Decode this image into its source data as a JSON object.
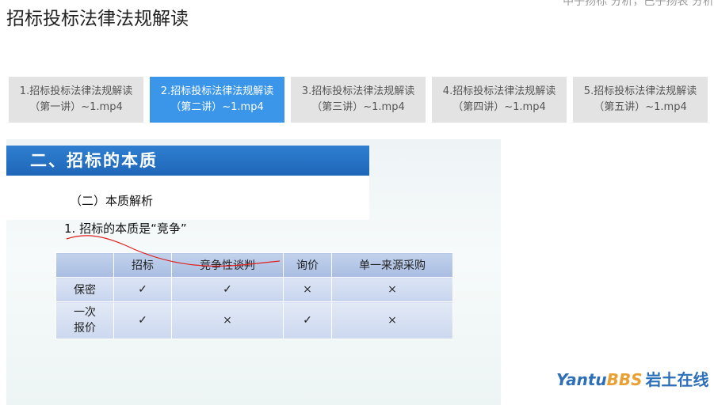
{
  "page": {
    "title": "招标投标法律法规解读"
  },
  "top_cut_text": "中子扬标  分析，巴子扬表  分析",
  "tabs": [
    {
      "line1": "1.招标投标法律法规解读",
      "line2": "（第一讲）~1.mp4",
      "active": false
    },
    {
      "line1": "2.招标投标法律法规解读",
      "line2": "（第二讲）~1.mp4",
      "active": true
    },
    {
      "line1": "3.招标投标法律法规解读",
      "line2": "（第三讲）~1.mp4",
      "active": false
    },
    {
      "line1": "4.招标投标法律法规解读",
      "line2": "（第四讲）~1.mp4",
      "active": false
    },
    {
      "line1": "5.招标投标法律法规解读",
      "line2": "（第五讲）~1.mp4",
      "active": false
    }
  ],
  "slide": {
    "heading": "二、招标的本质",
    "subheading": "（二）本质解析",
    "point": "1. 招标的本质是“竞争”",
    "table": {
      "headers": [
        "",
        "招标",
        "竞争性谈判",
        "询价",
        "单一来源采购"
      ],
      "rows": [
        {
          "label_line1": "保密",
          "label_line2": "",
          "cells": [
            "✓",
            "✓",
            "×",
            "×"
          ]
        },
        {
          "label_line1": "一次",
          "label_line2": "报价",
          "cells": [
            "✓",
            "×",
            "✓",
            "×"
          ]
        }
      ]
    },
    "pen_color": "#e0201c"
  },
  "watermark": {
    "part1": "Yantu",
    "part2": "BBS",
    "part3": "岩土在线"
  },
  "colors": {
    "tab_active": "#3b95e8",
    "tab_inactive": "#e3e3e3",
    "heading_bar": "#2370c4"
  }
}
